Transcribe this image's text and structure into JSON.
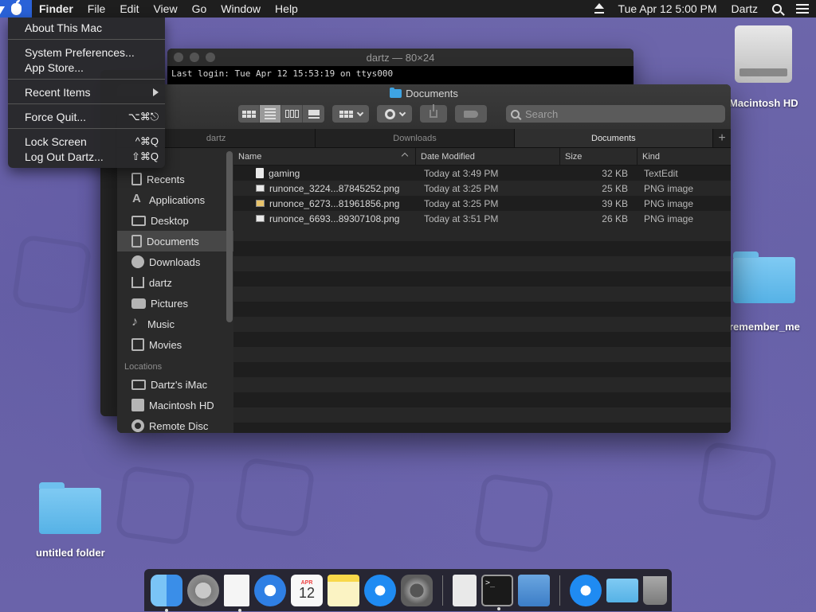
{
  "menubar": {
    "app": "Finder",
    "menus": [
      "File",
      "Edit",
      "View",
      "Go",
      "Window",
      "Help"
    ],
    "datetime": "Tue Apr 12  5:00 PM",
    "user": "Dartz"
  },
  "apple_menu": {
    "items": [
      {
        "label": "About This Mac",
        "shortcut": ""
      },
      {
        "label": "System Preferences...",
        "shortcut": ""
      },
      {
        "label": "App Store...",
        "shortcut": ""
      },
      {
        "label": "Recent Items",
        "shortcut": ""
      },
      {
        "label": "Force Quit...",
        "shortcut": "⌥⌘⎋"
      },
      {
        "label": "Lock Screen",
        "shortcut": "^⌘Q"
      },
      {
        "label": "Log Out Dartz...",
        "shortcut": "⇧⌘Q"
      }
    ]
  },
  "terminal": {
    "title": "dartz — 80×24",
    "line1": "Last login: Tue Apr 12 15:53:19 on ttys000"
  },
  "finder": {
    "title": "Documents",
    "search_placeholder": "Search",
    "tabs": [
      "dartz",
      "Downloads",
      "Documents"
    ],
    "sidebar": {
      "favorites": [
        "Recents",
        "Applications",
        "Desktop",
        "Documents",
        "Downloads",
        "dartz",
        "Pictures",
        "Music",
        "Movies"
      ],
      "locations_header": "Locations",
      "locations": [
        "Dartz's iMac",
        "Macintosh HD",
        "Remote Disc"
      ]
    },
    "columns": {
      "name": "Name",
      "date": "Date Modified",
      "size": "Size",
      "kind": "Kind"
    },
    "files": [
      {
        "name": "gaming",
        "date": "Today at 3:49 PM",
        "size": "32 KB",
        "kind": "TextEdit"
      },
      {
        "name": "runonce_3224...87845252.png",
        "date": "Today at 3:25 PM",
        "size": "25 KB",
        "kind": "PNG image"
      },
      {
        "name": "runonce_6273...81961856.png",
        "date": "Today at 3:25 PM",
        "size": "39 KB",
        "kind": "PNG image"
      },
      {
        "name": "runonce_6693...89307108.png",
        "date": "Today at 3:51 PM",
        "size": "26 KB",
        "kind": "PNG image"
      }
    ]
  },
  "desktop": {
    "icons": [
      "Macintosh HD",
      "remember_me",
      "untitled folder"
    ]
  },
  "dock": {
    "calendar_month": "APR",
    "calendar_day": "12",
    "terminal_prompt": ">_"
  }
}
